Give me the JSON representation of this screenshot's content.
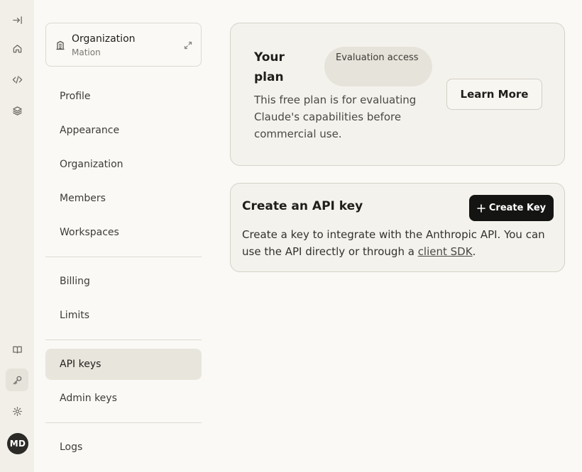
{
  "rail": {
    "user_initials": "MD",
    "icons": [
      "collapse-sidebar-icon",
      "home-icon",
      "code-icon",
      "layers-icon",
      "book-icon",
      "key-icon",
      "gear-icon"
    ]
  },
  "org_switcher": {
    "label": "Organization",
    "name": "Mation"
  },
  "nav": {
    "group1": [
      "Profile",
      "Appearance",
      "Organization",
      "Members",
      "Workspaces"
    ],
    "group2": [
      "Billing",
      "Limits"
    ],
    "group3": [
      "API keys",
      "Admin keys"
    ],
    "group4": [
      "Logs"
    ],
    "active": "API keys"
  },
  "plan_card": {
    "title": "Your plan",
    "badge": "Evaluation access",
    "description": "This free plan is for evaluating Claude's capabilities before commercial use.",
    "learn_more_label": "Learn More"
  },
  "api_card": {
    "title": "Create an API key",
    "create_button_label": "Create Key",
    "description_prefix": "Create a key to integrate with the Anthropic API. You can use the API directly or through a ",
    "link_text": "client SDK",
    "description_suffix": "."
  },
  "colors": {
    "background": "#faf9f5",
    "rail_background": "#f1efe8",
    "active_nav": "#e8e5dc",
    "primary_button": "#141413"
  }
}
